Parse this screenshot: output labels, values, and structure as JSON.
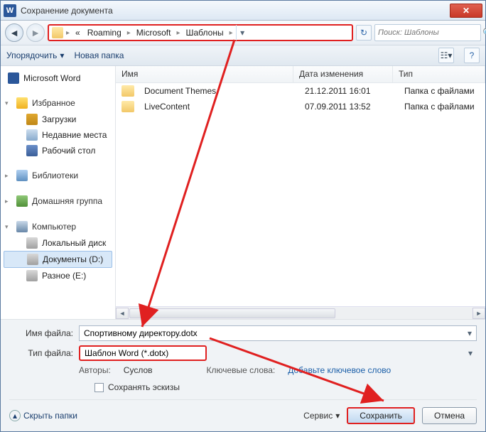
{
  "window": {
    "title": "Сохранение документа"
  },
  "breadcrumb": {
    "prefix": "«",
    "segments": [
      "Roaming",
      "Microsoft",
      "Шаблоны"
    ]
  },
  "search": {
    "placeholder": "Поиск: Шаблоны"
  },
  "toolbar": {
    "organize": "Упорядочить",
    "newfolder": "Новая папка"
  },
  "nav": {
    "word": "Microsoft Word",
    "fav": "Избранное",
    "downloads": "Загрузки",
    "recent": "Недавние места",
    "desktop": "Рабочий стол",
    "libs": "Библиотеки",
    "homegroup": "Домашняя группа",
    "computer": "Компьютер",
    "local": "Локальный диск",
    "docs": "Документы (D:)",
    "misc": "Разное (E:)"
  },
  "columns": {
    "name": "Имя",
    "date": "Дата изменения",
    "type": "Тип"
  },
  "files": [
    {
      "name": "Document Themes",
      "date": "21.12.2011 16:01",
      "type": "Папка с файлами"
    },
    {
      "name": "LiveContent",
      "date": "07.09.2011 13:52",
      "type": "Папка с файлами"
    }
  ],
  "form": {
    "nameLabel": "Имя файла:",
    "nameValue": "Спортивному директору.dotx",
    "typeLabel": "Тип файла:",
    "typeValue": "Шаблон Word (*.dotx)",
    "authorsLabel": "Авторы:",
    "authorsValue": "Суслов",
    "keywordsLabel": "Ключевые слова:",
    "keywordsAdd": "Добавьте ключевое слово",
    "thumb": "Сохранять эскизы"
  },
  "actions": {
    "hide": "Скрыть папки",
    "service": "Сервис",
    "save": "Сохранить",
    "cancel": "Отмена"
  }
}
